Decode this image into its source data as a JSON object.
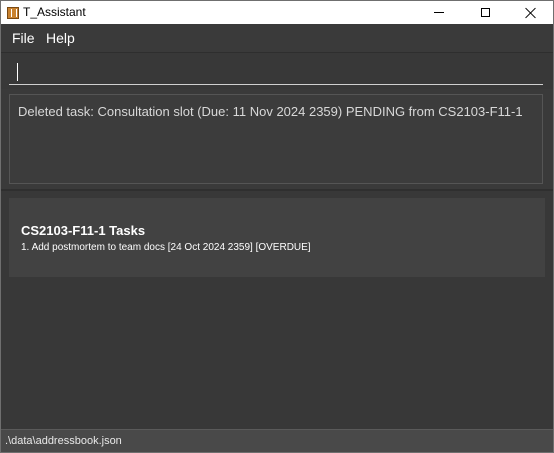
{
  "window": {
    "title": "T_Assistant",
    "icon": "app-icon"
  },
  "menu": {
    "file_label": "File",
    "help_label": "Help"
  },
  "command": {
    "value": "",
    "placeholder": ""
  },
  "result": {
    "message": "Deleted task: Consultation slot (Due: 11 Nov 2024 2359) PENDING from CS2103-F11-1"
  },
  "task_list": {
    "group_title": "CS2103-F11-1 Tasks",
    "items": [
      "1. Add postmortem to team docs [24 Oct 2024 2359] [OVERDUE]"
    ]
  },
  "status_bar": {
    "file_path": ".\\data\\addressbook.json"
  },
  "colors": {
    "background": "#3c3c3c",
    "card": "#424242",
    "text": "#ffffff",
    "title_bar": "#ffffff"
  }
}
